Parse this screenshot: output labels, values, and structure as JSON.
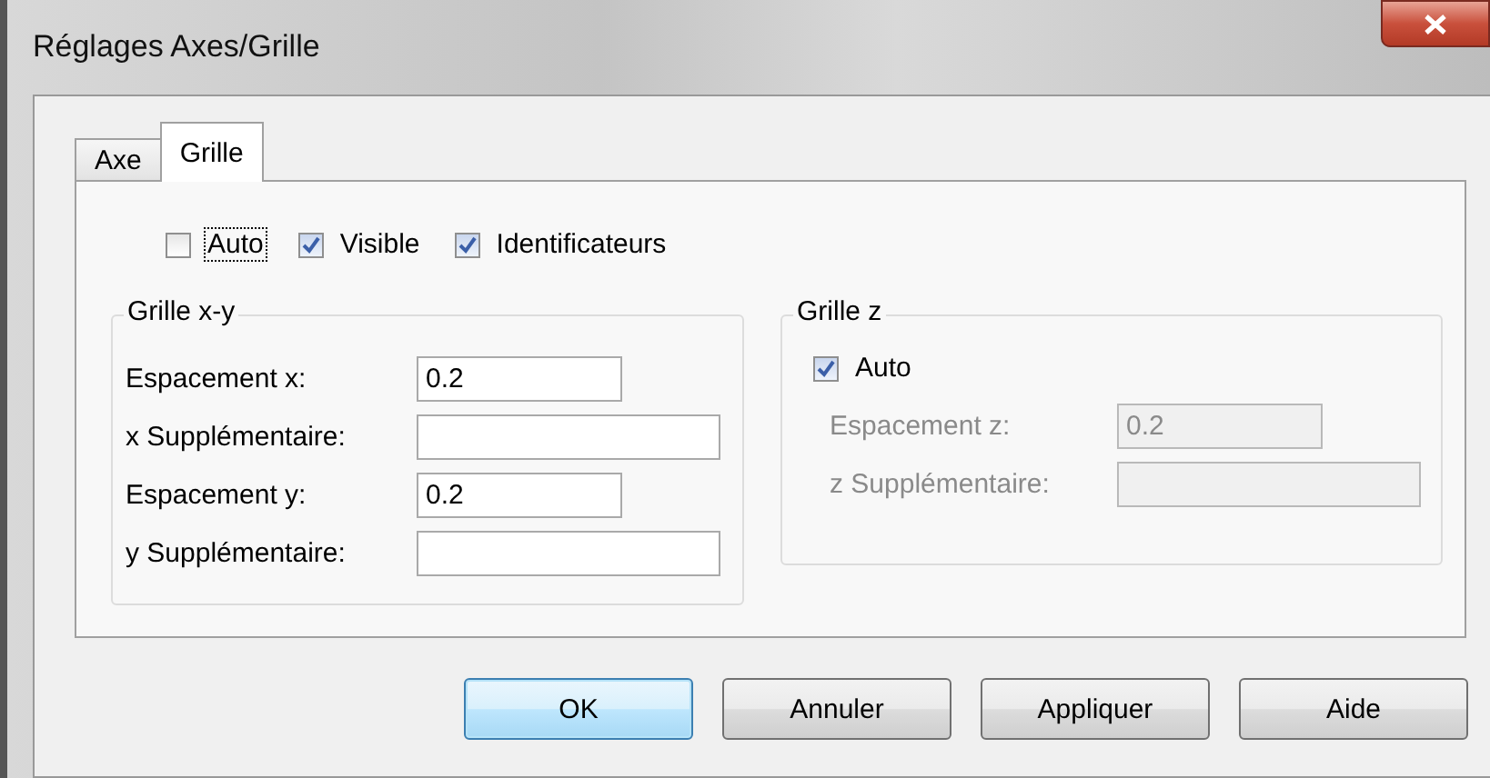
{
  "window": {
    "title": "Réglages Axes/Grille"
  },
  "tabs": [
    {
      "label": "Axe",
      "selected": false
    },
    {
      "label": "Grille",
      "selected": true
    }
  ],
  "options": [
    {
      "label": "Auto",
      "checked": false,
      "focused": true
    },
    {
      "label": "Visible",
      "checked": true,
      "focused": false
    },
    {
      "label": "Identificateurs",
      "checked": true,
      "focused": false
    }
  ],
  "grid_xy": {
    "title": "Grille x-y",
    "fields": [
      {
        "label": "Espacement x:",
        "value": "0.2",
        "disabled": false
      },
      {
        "label": "x Supplémentaire:",
        "disabled": false
      },
      {
        "label": "Espacement y:",
        "value": "0.2",
        "disabled": false
      },
      {
        "label": "y Supplémentaire:",
        "disabled": false
      }
    ]
  },
  "grid_z": {
    "title": "Grille z",
    "auto": {
      "label": "Auto",
      "checked": true
    },
    "fields": [
      {
        "label": "Espacement z:",
        "value": "0.2",
        "disabled": true
      },
      {
        "label": "z Supplémentaire:",
        "disabled": true
      }
    ]
  },
  "buttons": [
    {
      "label": "OK",
      "default": true
    },
    {
      "label": "Annuler",
      "default": false
    },
    {
      "label": "Appliquer",
      "default": false
    },
    {
      "label": "Aide",
      "default": false
    }
  ]
}
